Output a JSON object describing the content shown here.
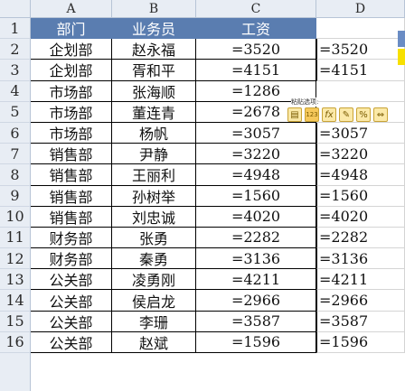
{
  "columns": [
    "A",
    "B",
    "C",
    "D"
  ],
  "header": {
    "dept": "部门",
    "staff": "业务员",
    "salary": "工资"
  },
  "rows": [
    {
      "num": "1"
    },
    {
      "num": "2",
      "dept": "企划部",
      "staff": "赵永福",
      "salary": "=3520",
      "d": "=3520"
    },
    {
      "num": "3",
      "dept": "企划部",
      "staff": "胥和平",
      "salary": "=4151",
      "d": "=4151"
    },
    {
      "num": "4",
      "dept": "市场部",
      "staff": "张海顺",
      "salary": "=1286",
      "d": ""
    },
    {
      "num": "5",
      "dept": "市场部",
      "staff": "董连青",
      "salary": "=2678",
      "d": ""
    },
    {
      "num": "6",
      "dept": "市场部",
      "staff": "杨帆",
      "salary": "=3057",
      "d": "=3057"
    },
    {
      "num": "7",
      "dept": "销售部",
      "staff": "尹静",
      "salary": "=3220",
      "d": "=3220"
    },
    {
      "num": "8",
      "dept": "销售部",
      "staff": "王丽利",
      "salary": "=4948",
      "d": "=4948"
    },
    {
      "num": "9",
      "dept": "销售部",
      "staff": "孙树举",
      "salary": "=1560",
      "d": "=1560"
    },
    {
      "num": "10",
      "dept": "销售部",
      "staff": "刘忠诚",
      "salary": "=4020",
      "d": "=4020"
    },
    {
      "num": "11",
      "dept": "财务部",
      "staff": "张勇",
      "salary": "=2282",
      "d": "=2282"
    },
    {
      "num": "12",
      "dept": "财务部",
      "staff": "秦勇",
      "salary": "=3136",
      "d": "=3136"
    },
    {
      "num": "13",
      "dept": "公关部",
      "staff": "凌勇刚",
      "salary": "=4211",
      "d": "=4211"
    },
    {
      "num": "14",
      "dept": "公关部",
      "staff": "侯启龙",
      "salary": "=2966",
      "d": "=2966"
    },
    {
      "num": "15",
      "dept": "公关部",
      "staff": "李珊",
      "salary": "=3587",
      "d": "=3587"
    },
    {
      "num": "16",
      "dept": "公关部",
      "staff": "赵斌",
      "salary": "=1596",
      "d": "=1596"
    }
  ],
  "paste_toolbar": {
    "title": "粘贴选项:",
    "buttons": [
      {
        "icon": "paste-icon",
        "glyph": "▤"
      },
      {
        "icon": "paste-values-icon",
        "glyph": "123"
      },
      {
        "icon": "paste-formulas-icon",
        "glyph": "fx"
      },
      {
        "icon": "paste-formatting-icon",
        "glyph": "✎"
      },
      {
        "icon": "paste-percent-icon",
        "glyph": "%"
      },
      {
        "icon": "paste-link-icon",
        "glyph": "⇔"
      }
    ]
  },
  "colors": {
    "header_fill": "#5a7db0",
    "header_text": "#ffffff",
    "row_header_fill": "#e8edf4",
    "cell_border": "#000000",
    "accent_yellow": "#f7e000"
  }
}
